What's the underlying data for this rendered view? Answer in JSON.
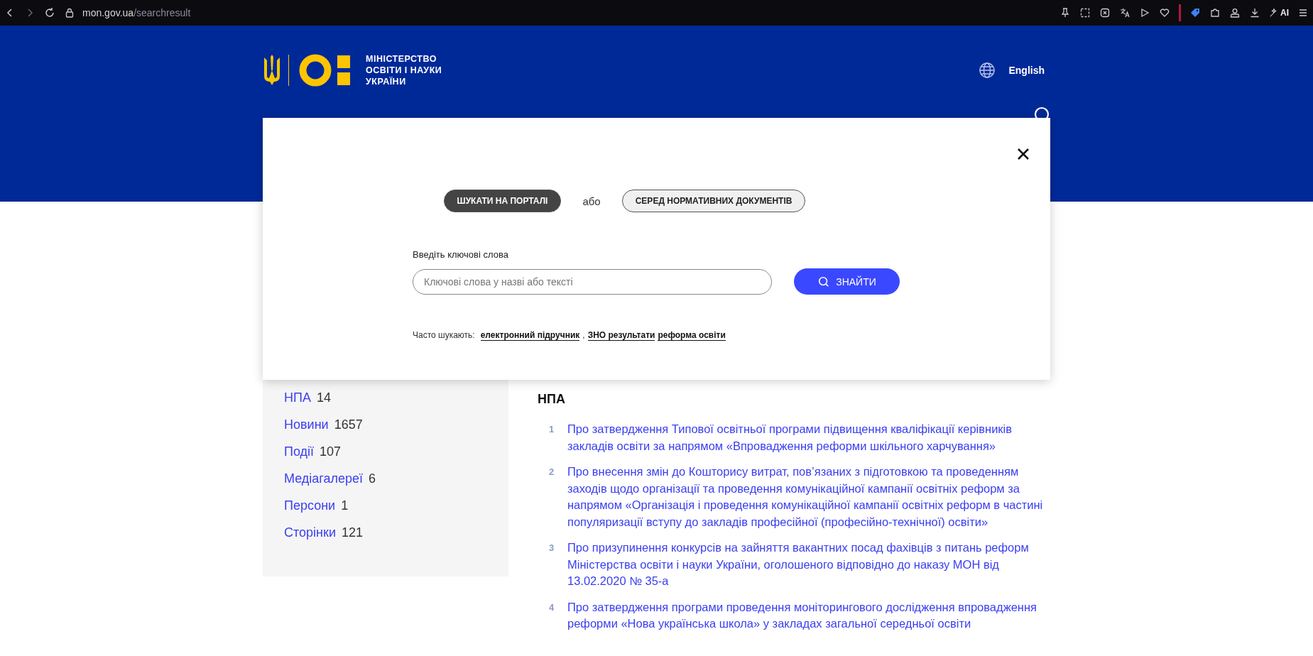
{
  "browser": {
    "url_host": "mon.gov.ua",
    "url_path": "/searchresult",
    "ai_label": "AI"
  },
  "header": {
    "logo_text": "МІНІСТЕРСТВО\nОСВІТИ І НАУКИ\nУКРАЇНИ",
    "language": "English"
  },
  "search_modal": {
    "scopes": [
      {
        "label": "ШУКАТИ НА ПОРТАЛІ",
        "selected": true
      },
      {
        "label": "СЕРЕД НОРМАТИВНИХ ДОКУМЕНТІВ",
        "selected": false
      }
    ],
    "separator": "або",
    "field_label": "Введіть ключові слова",
    "placeholder": "Ключові слова у назві або тексті",
    "submit": "ЗНАЙТИ",
    "popular_label": "Часто шукають:",
    "popular": [
      {
        "label": "електронний підручник",
        "suffix": ","
      },
      {
        "label": "ЗНО результати"
      },
      {
        "label": "реформа освіти"
      }
    ]
  },
  "sidebar": {
    "categories": [
      {
        "label": "НПА",
        "count": "14"
      },
      {
        "label": "Новини",
        "count": "1657"
      },
      {
        "label": "Події",
        "count": "107"
      },
      {
        "label": "Медіагалереї",
        "count": "6"
      },
      {
        "label": "Персони",
        "count": "1"
      },
      {
        "label": "Сторінки",
        "count": "121"
      }
    ]
  },
  "results": {
    "heading": "НПА",
    "items": [
      {
        "number": "1",
        "title": "Про затвердження Типової освітньої програми підвищення кваліфікації керівників закладів освіти за напрямом «Впровадження реформи шкільного харчування»"
      },
      {
        "number": "2",
        "title": "Про внесення змін до Кошторису витрат, пов’язаних з підготовкою та проведенням заходів щодо організації та проведення комунікаційної кампанії освітніх реформ за напрямом «Організація і проведення комунікаційної кампанії освітніх реформ в частині популяризації вступу до закладів професійної (професійно-технічної) освіти»"
      },
      {
        "number": "3",
        "title": "Про призупинення конкурсів на зайняття вакантних посад фахівців з питань реформ Міністерства освіти і науки України, оголошеного відповідно до наказу МОН від 13.02.2020 № 35-а"
      },
      {
        "number": "4",
        "title": "Про затвердження програми проведення моніторингового дослідження впровадження реформи «Нова українська школа» у закладах загальної середньої освіти"
      }
    ]
  }
}
